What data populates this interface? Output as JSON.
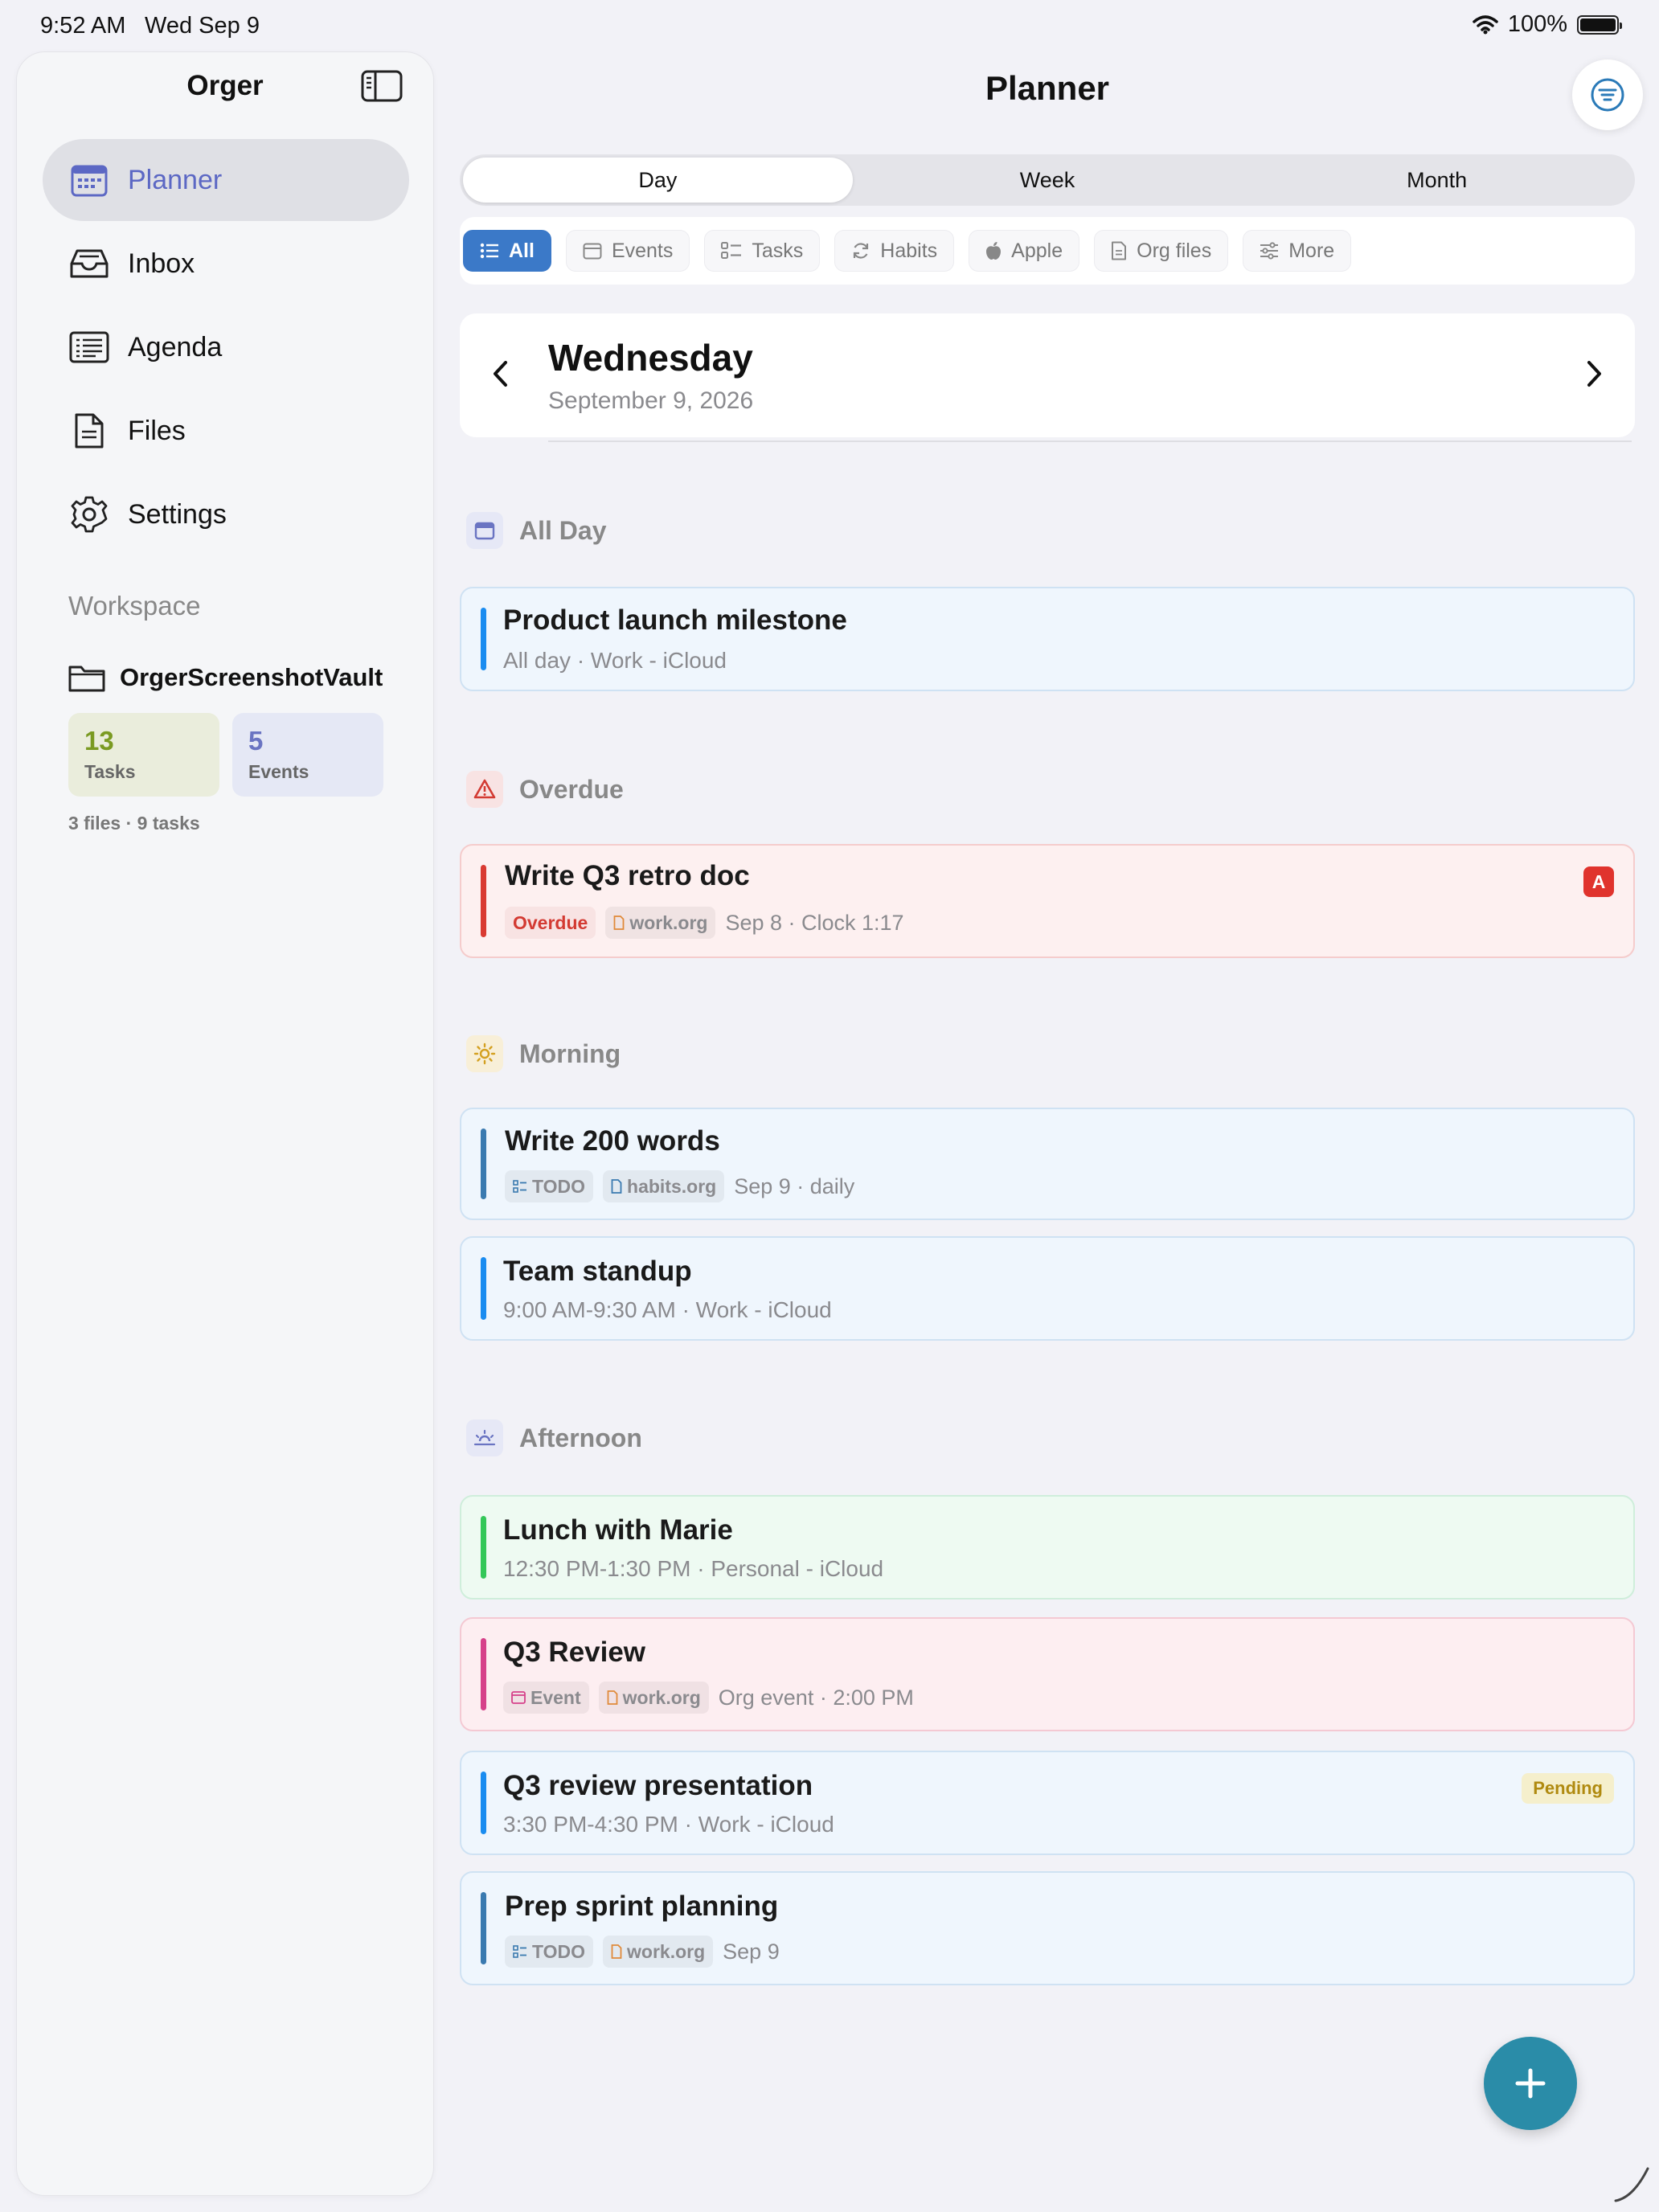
{
  "status_bar": {
    "time": "9:52 AM",
    "date": "Wed Sep 9",
    "battery": "100%"
  },
  "sidebar": {
    "title": "Orger",
    "items": [
      {
        "label": "Planner",
        "icon": "calendar-icon"
      },
      {
        "label": "Inbox",
        "icon": "inbox-icon"
      },
      {
        "label": "Agenda",
        "icon": "agenda-icon"
      },
      {
        "label": "Files",
        "icon": "file-icon"
      },
      {
        "label": "Settings",
        "icon": "gear-icon"
      }
    ],
    "active_index": 0,
    "workspace": {
      "label": "Workspace",
      "vault_name": "OrgerScreenshotVault",
      "tasks_count": "13",
      "tasks_label": "Tasks",
      "events_count": "5",
      "events_label": "Events",
      "summary": "3 files · 9 tasks"
    }
  },
  "main": {
    "title": "Planner",
    "segments": [
      "Day",
      "Week",
      "Month"
    ],
    "active_segment": 0,
    "filters": [
      {
        "label": "All",
        "icon": "list-icon",
        "active": true
      },
      {
        "label": "Events",
        "icon": "calendar-icon"
      },
      {
        "label": "Tasks",
        "icon": "checklist-icon"
      },
      {
        "label": "Habits",
        "icon": "repeat-icon"
      },
      {
        "label": "Apple",
        "icon": "apple-icon"
      },
      {
        "label": "Org files",
        "icon": "document-icon"
      },
      {
        "label": "More",
        "icon": "sliders-icon"
      }
    ],
    "day_header": {
      "weekday": "Wednesday",
      "date": "September 9, 2026"
    },
    "sections": {
      "all_day": "All Day",
      "overdue": "Overdue",
      "morning": "Morning",
      "afternoon": "Afternoon"
    },
    "items": {
      "product_launch": {
        "title": "Product launch milestone",
        "subtitle": "All day · Work - iCloud",
        "color": "#1a8cf0"
      },
      "q3_retro": {
        "title": "Write Q3 retro doc",
        "status_tag": "Overdue",
        "file_tag": "work.org",
        "detail": "Sep 8 · Clock 1:17",
        "priority": "A",
        "color": "#d93a32"
      },
      "write_200": {
        "title": "Write 200 words",
        "kind_tag": "TODO",
        "file_tag": "habits.org",
        "detail": "Sep 9 · daily",
        "color": "#3a7ab0"
      },
      "standup": {
        "title": "Team standup",
        "subtitle": "9:00 AM-9:30 AM · Work - iCloud",
        "color": "#1a8cf0"
      },
      "lunch": {
        "title": "Lunch with Marie",
        "subtitle": "12:30 PM-1:30 PM · Personal - iCloud",
        "color": "#34c759"
      },
      "q3_review": {
        "title": "Q3 Review",
        "kind_tag": "Event",
        "file_tag": "work.org",
        "detail": "Org event · 2:00 PM",
        "color": "#d6418a"
      },
      "q3_presentation": {
        "title": "Q3 review presentation",
        "subtitle": "3:30 PM-4:30 PM · Work - iCloud",
        "badge": "Pending",
        "color": "#1a8cf0"
      },
      "sprint": {
        "title": "Prep sprint planning",
        "kind_tag": "TODO",
        "file_tag": "work.org",
        "detail": "Sep 9",
        "color": "#3a7ab0"
      }
    }
  }
}
